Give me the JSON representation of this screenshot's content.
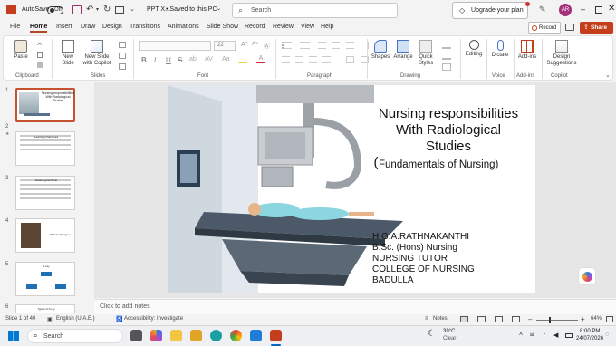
{
  "titlebar": {
    "autosave": "AutoSave",
    "autosave_state": "Off",
    "doc_title": "PPT X...",
    "saved_status": "• Saved to this PC",
    "search_placeholder": "Search",
    "upgrade": "Upgrade your plan",
    "avatar_initials": "AR"
  },
  "menu": {
    "tabs": [
      "File",
      "Home",
      "Insert",
      "Draw",
      "Design",
      "Transitions",
      "Animations",
      "Slide Show",
      "Record",
      "Review",
      "View",
      "Help"
    ],
    "active": "Home",
    "record_btn": "Record",
    "share_btn": "Share"
  },
  "ribbon": {
    "clipboard": {
      "paste": "Paste",
      "label": "Clipboard"
    },
    "slides": {
      "new_slide": "New\nSlide",
      "reuse": "New Slide\nwith Copilot",
      "label": "Slides"
    },
    "font": {
      "size": "22",
      "label": "Font",
      "bold": "B",
      "italic": "I",
      "underline": "U",
      "strike": "S"
    },
    "paragraph": {
      "label": "Paragraph"
    },
    "drawing": {
      "shapes": "Shapes",
      "arrange": "Arrange",
      "quick_styles": "Quick\nStyles",
      "label": "Drawing"
    },
    "editing": {
      "label_btn": "Editing"
    },
    "voice": {
      "dictate": "Dictate",
      "label": "Voice"
    },
    "addins": {
      "btn": "Add-ins",
      "label": "Add-ins"
    },
    "designer": {
      "btn": "Design\nSuggestions",
      "label": "Copilot"
    }
  },
  "thumbs": [
    {
      "num": "1",
      "title": "Nursing responsibilities With Radiological Studies"
    },
    {
      "num": "2",
      "title": "Learning Outcomes"
    },
    {
      "num": "3",
      "title": "Radiological Tests"
    },
    {
      "num": "4",
      "title": "Wilhelm Röntgen"
    },
    {
      "num": "5",
      "title": "X-ray"
    },
    {
      "num": "6",
      "title": "Types of X-ray"
    }
  ],
  "slide": {
    "title_l1": "Nursing responsibilities",
    "title_l2": "With Radiological",
    "title_l3": "Studies",
    "title_paren": "(",
    "title_l4": "Fundamentals of Nursing)",
    "author": "H.G.A.RATHNAKANTHI",
    "degree": "B.Sc. (Hons) Nursing",
    "role": "NURSING TUTOR",
    "college": "COLLEGE OF NURSING",
    "city": "BADULLA"
  },
  "notes_placeholder": "Click to add notes",
  "status": {
    "slide_count": "Slide 1 of 40",
    "language": "English (U.A.E.)",
    "accessibility": "Accessibility: Investigate",
    "notes": "Notes",
    "zoom": "64%"
  },
  "taskbar": {
    "search": "Search",
    "weather_temp": "39°C",
    "weather_desc": "Clear",
    "time": "8:00 PM",
    "date": "24/07/2026"
  },
  "colors": {
    "accent": "#c43e1c",
    "share": "#c43e1c",
    "avatar": "#a4317a"
  }
}
